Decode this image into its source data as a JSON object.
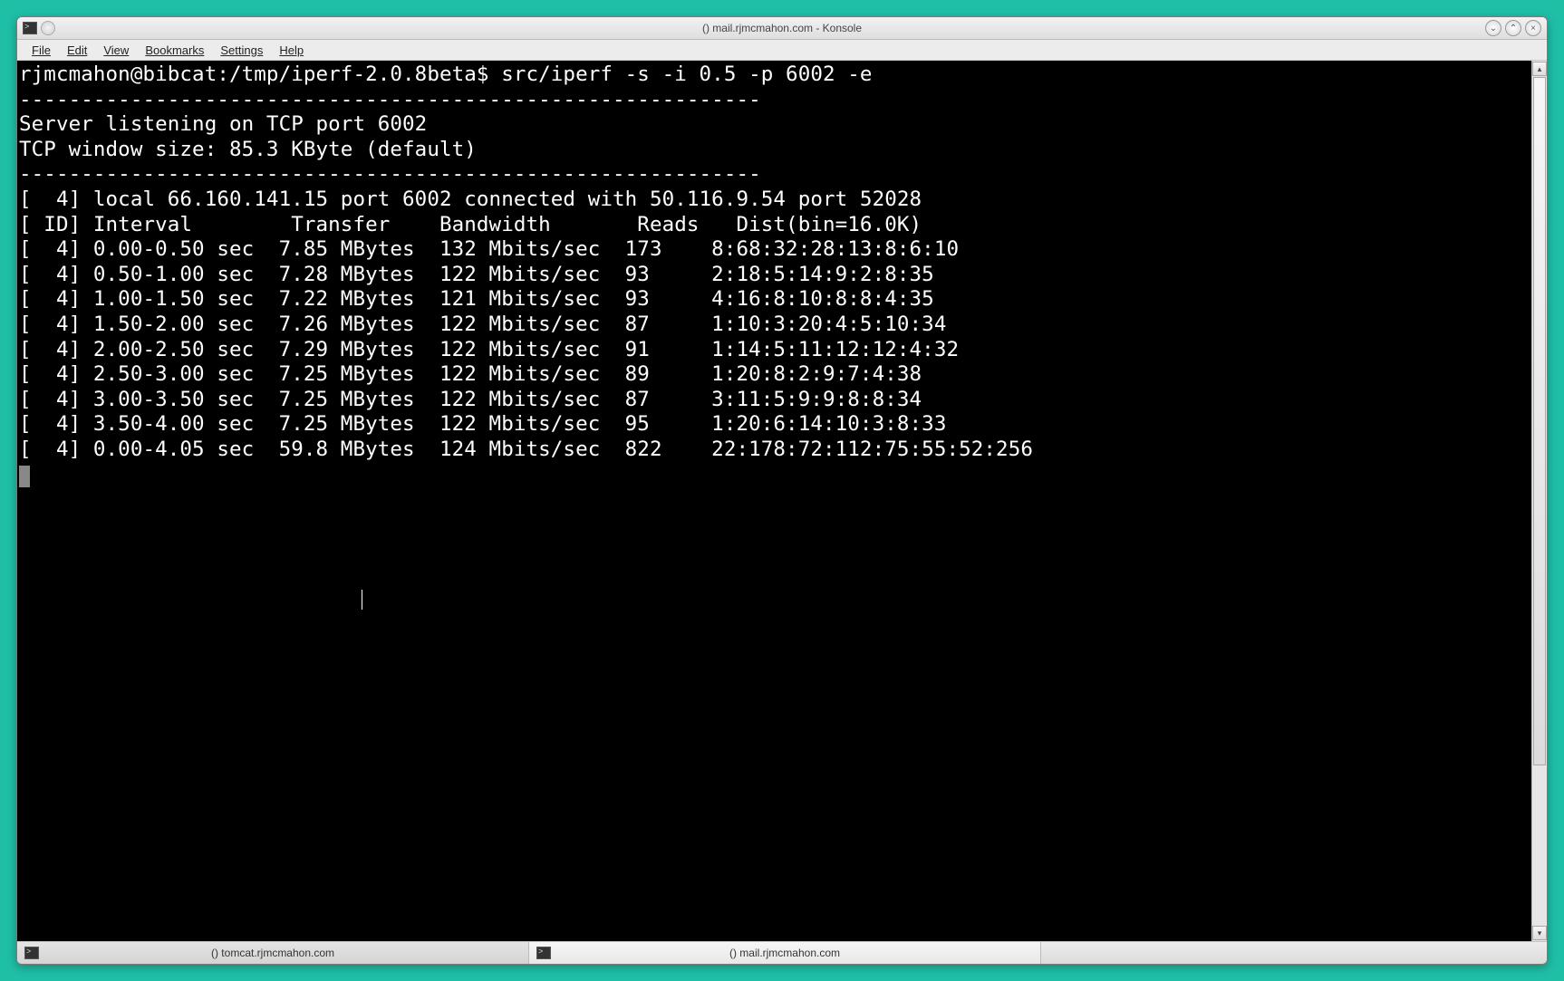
{
  "window": {
    "title": "() mail.rjmcmahon.com - Konsole"
  },
  "menubar": {
    "items": [
      "File",
      "Edit",
      "View",
      "Bookmarks",
      "Settings",
      "Help"
    ]
  },
  "terminal": {
    "prompt": "rjmcmahon@bibcat:/tmp/iperf-2.0.8beta$",
    "command": "src/iperf -s -i 0.5 -p 6002 -e",
    "separator": "------------------------------------------------------------",
    "server_listening": "Server listening on TCP port 6002",
    "tcp_window": "TCP window size: 85.3 KByte (default)",
    "connection_line": "[  4] local 66.160.141.15 port 6002 connected with 50.116.9.54 port 52028",
    "header": "[ ID] Interval        Transfer    Bandwidth       Reads   Dist(bin=16.0K)",
    "rows": [
      {
        "id": "4",
        "interval": "0.00-0.50 sec",
        "transfer": "7.85 MBytes",
        "bandwidth": "132 Mbits/sec",
        "reads": "173",
        "dist": "8:68:32:28:13:8:6:10"
      },
      {
        "id": "4",
        "interval": "0.50-1.00 sec",
        "transfer": "7.28 MBytes",
        "bandwidth": "122 Mbits/sec",
        "reads": "93",
        "dist": "2:18:5:14:9:2:8:35"
      },
      {
        "id": "4",
        "interval": "1.00-1.50 sec",
        "transfer": "7.22 MBytes",
        "bandwidth": "121 Mbits/sec",
        "reads": "93",
        "dist": "4:16:8:10:8:8:4:35"
      },
      {
        "id": "4",
        "interval": "1.50-2.00 sec",
        "transfer": "7.26 MBytes",
        "bandwidth": "122 Mbits/sec",
        "reads": "87",
        "dist": "1:10:3:20:4:5:10:34"
      },
      {
        "id": "4",
        "interval": "2.00-2.50 sec",
        "transfer": "7.29 MBytes",
        "bandwidth": "122 Mbits/sec",
        "reads": "91",
        "dist": "1:14:5:11:12:12:4:32"
      },
      {
        "id": "4",
        "interval": "2.50-3.00 sec",
        "transfer": "7.25 MBytes",
        "bandwidth": "122 Mbits/sec",
        "reads": "89",
        "dist": "1:20:8:2:9:7:4:38"
      },
      {
        "id": "4",
        "interval": "3.00-3.50 sec",
        "transfer": "7.25 MBytes",
        "bandwidth": "122 Mbits/sec",
        "reads": "87",
        "dist": "3:11:5:9:9:8:8:34"
      },
      {
        "id": "4",
        "interval": "3.50-4.00 sec",
        "transfer": "7.25 MBytes",
        "bandwidth": "122 Mbits/sec",
        "reads": "95",
        "dist": "1:20:6:14:10:3:8:33"
      },
      {
        "id": "4",
        "interval": "0.00-4.05 sec",
        "transfer": "59.8 MBytes",
        "bandwidth": "124 Mbits/sec",
        "reads": "822",
        "dist": "22:178:72:112:75:55:52:256"
      }
    ]
  },
  "tabs": [
    {
      "label": "() tomcat.rjmcmahon.com",
      "active": false
    },
    {
      "label": "() mail.rjmcmahon.com",
      "active": true
    }
  ]
}
